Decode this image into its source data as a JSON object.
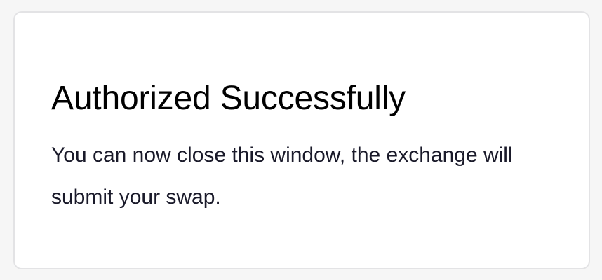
{
  "dialog": {
    "title": "Authorized Successfully",
    "message": "You can now close this window, the exchange will submit your swap."
  },
  "colors": {
    "page_background": "#f6f6f6",
    "card_background": "#ffffff",
    "card_border": "#e3e3e5",
    "title_text": "#000000",
    "message_text": "#1a1a2a"
  }
}
